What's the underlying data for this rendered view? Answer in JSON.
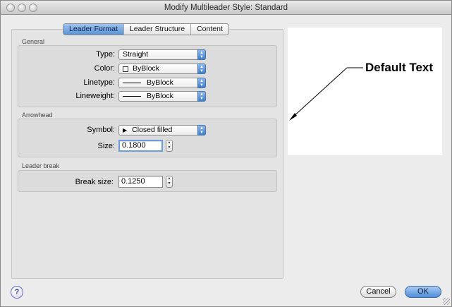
{
  "window": {
    "title": "Modify Multileader Style: Standard"
  },
  "tabs": [
    {
      "label": "Leader Format",
      "active": true
    },
    {
      "label": "Leader Structure",
      "active": false
    },
    {
      "label": "Content",
      "active": false
    }
  ],
  "general": {
    "section_label": "General",
    "type": {
      "label": "Type:",
      "value": "Straight"
    },
    "color": {
      "label": "Color:",
      "value": "ByBlock"
    },
    "linetype": {
      "label": "Linetype:",
      "value": "ByBlock"
    },
    "lineweight": {
      "label": "Lineweight:",
      "value": "ByBlock"
    }
  },
  "arrowhead": {
    "section_label": "Arrowhead",
    "symbol": {
      "label": "Symbol:",
      "value": "Closed filled"
    },
    "size": {
      "label": "Size:",
      "value": "0.1800"
    }
  },
  "leader_break": {
    "section_label": "Leader break",
    "break_size": {
      "label": "Break size:",
      "value": "0.1250"
    }
  },
  "preview": {
    "text": "Default Text"
  },
  "buttons": {
    "help": "?",
    "cancel": "Cancel",
    "ok": "OK"
  },
  "icons": {
    "popup_arrows": "updown-chevron-icon",
    "stepper": "stepper-icon",
    "help": "help-icon"
  }
}
